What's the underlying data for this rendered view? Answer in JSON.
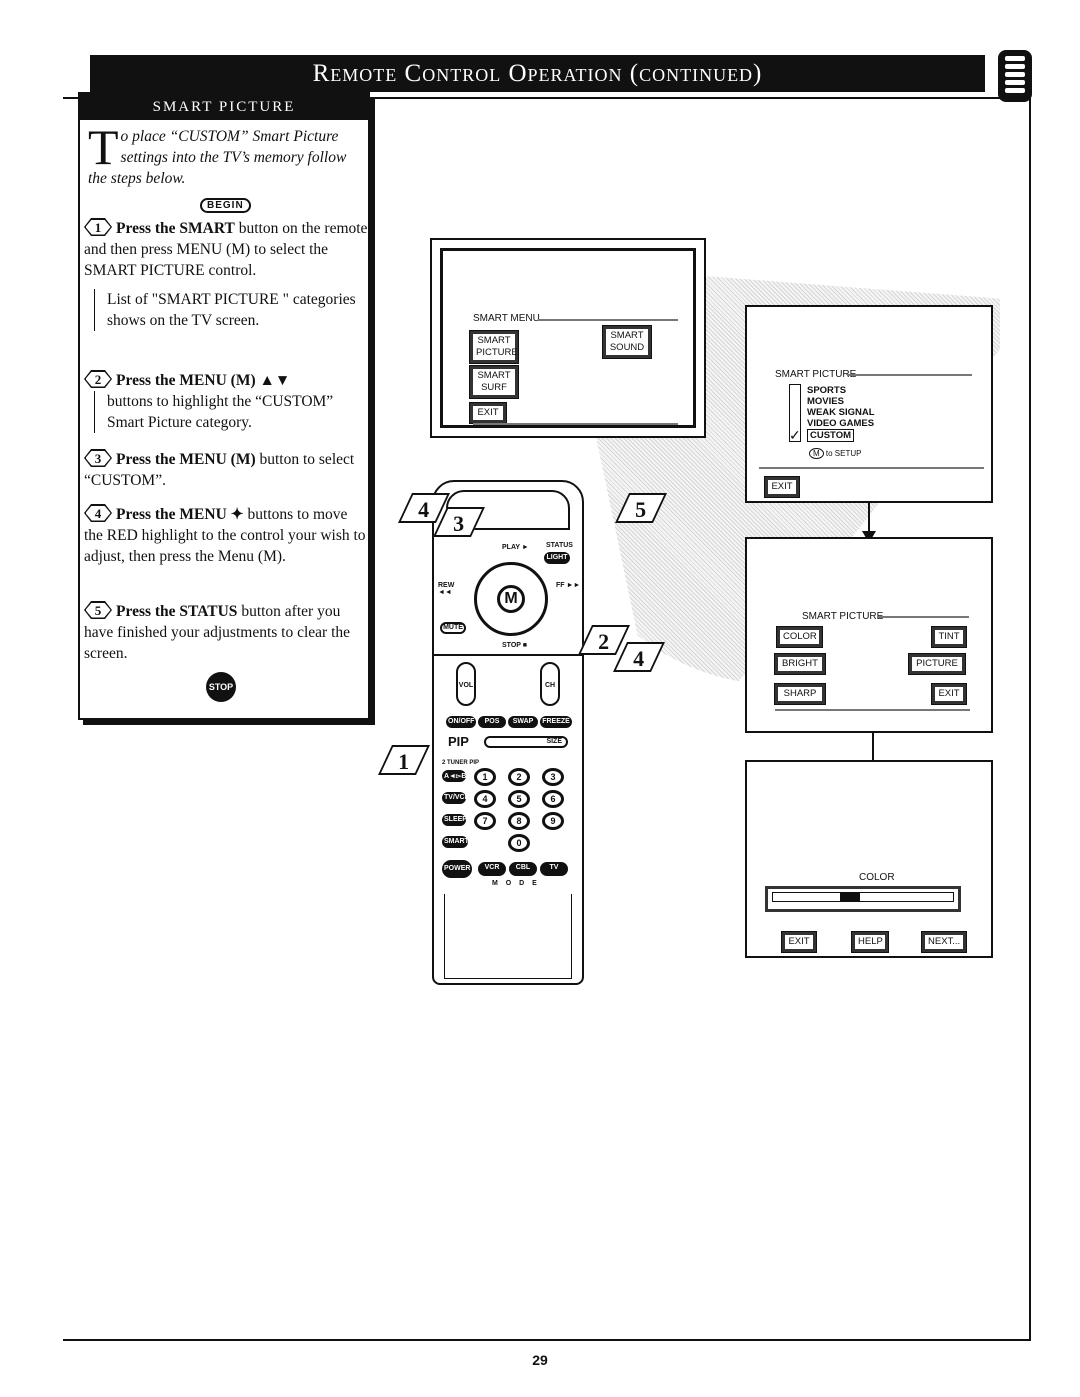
{
  "header": {
    "title": "Remote Control Operation (continued)",
    "remote_icon": "remote-control-icon"
  },
  "panel": {
    "title": "SMART PICTURE",
    "intro_cap": "T",
    "intro": "o place “CUSTOM” Smart Picture settings into the TV’s memory follow the steps below.",
    "begin": "BEGIN",
    "steps": [
      {
        "num": "1",
        "bold": "Press the SMART",
        "text": " button on the remote and then press MENU (M) to select the SMART PICTURE control.",
        "note": "List of \"SMART PICTURE \" categories shows on the TV screen."
      },
      {
        "num": "2",
        "bold": "Press the MENU (M) ▲▼",
        "text": "buttons  to highlight the “CUSTOM” Smart Picture category."
      },
      {
        "num": "3",
        "bold": "Press the MENU (M)",
        "text": " button to select “CUSTOM”."
      },
      {
        "num": "4",
        "bold": "Press the MENU ✦",
        "text": " buttons to move the RED highlight to the control your wish to adjust, then press the Menu (M)."
      },
      {
        "num": "5",
        "bold": "Press the STATUS",
        "text": " button after you have finished your adjustments to clear the screen."
      }
    ],
    "stop": "STOP"
  },
  "screen1": {
    "title": "SMART MENU",
    "buttons": [
      "SMART PICTURE",
      "SMART SOUND",
      "SMART SURF",
      "EXIT"
    ]
  },
  "screen2": {
    "title": "SMART PICTURE",
    "items": [
      "SPORTS",
      "MOVIES",
      "WEAK SIGNAL",
      "VIDEO GAMES",
      "CUSTOM"
    ],
    "selected": "CUSTOM",
    "hint_key": "M",
    "hint": "to SETUP",
    "exit": "EXIT"
  },
  "screen3": {
    "title": "SMART PICTURE",
    "buttons": [
      "COLOR",
      "TINT",
      "BRIGHT",
      "PICTURE",
      "SHARP",
      "EXIT"
    ]
  },
  "screen4": {
    "label": "COLOR",
    "buttons": [
      "EXIT",
      "HELP",
      "NEXT..."
    ]
  },
  "remote": {
    "play": "PLAY ►",
    "status": "STATUS",
    "light": "LIGHT",
    "rew": "REW ◄◄",
    "ff": "FF ►►",
    "menu": "M",
    "mute": "MUTE",
    "stop": "STOP ■",
    "vol": "VOL",
    "ch": "CH",
    "pip_row": [
      "ON/OFF",
      "POS",
      "SWAP",
      "FREEZE"
    ],
    "pip": "PIP",
    "size": "SIZE",
    "tuner": "2 TUNER PIP",
    "ab": "A◄▻B",
    "tvvcr": "TV/VCR",
    "sleep": "SLEEP",
    "smart": "SMART",
    "digits": [
      "1",
      "2",
      "3",
      "4",
      "5",
      "6",
      "7",
      "8",
      "9",
      "0"
    ],
    "power": "POWER",
    "modes": [
      "VCR",
      "CBL",
      "TV"
    ],
    "mode": "M O D E",
    "callouts": [
      "1",
      "2",
      "3",
      "4",
      "4",
      "5"
    ]
  },
  "page_number": "29"
}
